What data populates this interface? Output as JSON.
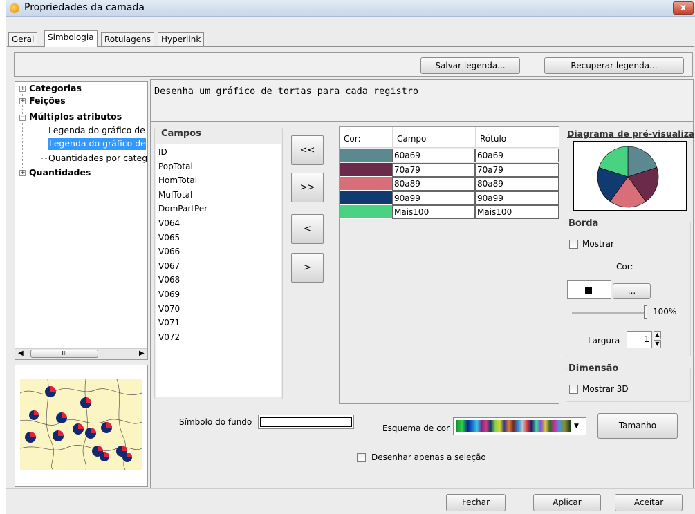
{
  "window": {
    "title": "Propriedades da camada",
    "close_label": "x"
  },
  "tabs": [
    "Geral",
    "Simbologia",
    "Rotulagens",
    "Hyperlink"
  ],
  "toolbar": {
    "save_legend": "Salvar legenda...",
    "recover_legend": "Recuperar legenda..."
  },
  "tree": {
    "categorias": "Categorias",
    "feicoes": "Feições",
    "multiplos": "Múltiplos atributos",
    "child1": "Legenda do gráfico de",
    "child2": "Legenda do gráfico de",
    "child3": "Quantidades por categ",
    "quantidades": "Quantidades"
  },
  "description": "Desenha um gráfico de tortas para cada registro",
  "campos": {
    "title": "Campos",
    "items": [
      "ID",
      "PopTotal",
      "HomTotal",
      "MulTotal",
      "DomPartPer",
      "V064",
      "V065",
      "V066",
      "V067",
      "V068",
      "V069",
      "V070",
      "V071",
      "V072"
    ]
  },
  "arrows": {
    "add_all": "<<",
    "remove_all": ">>",
    "add_one": "<",
    "remove_one": ">"
  },
  "table": {
    "headers": {
      "color": "Cor:",
      "field": "Campo",
      "label": "Rótulo"
    },
    "rows": [
      {
        "color": "#5b8891",
        "field": "60a69",
        "label": "60a69"
      },
      {
        "color": "#6b2a49",
        "field": "70a79",
        "label": "70a79"
      },
      {
        "color": "#d86e78",
        "field": "80a89",
        "label": "80a89"
      },
      {
        "color": "#103a70",
        "field": "90a99",
        "label": "90a99"
      },
      {
        "color": "#48d282",
        "field": "Mais100",
        "label": "Mais100"
      }
    ]
  },
  "preview": {
    "title": "Diagrama de pré-visualização"
  },
  "borda": {
    "title": "Borda",
    "show_label": "Mostrar",
    "color_label": "Cor:",
    "ellipsis": "...",
    "percent": "100%",
    "width_label": "Largura",
    "width_value": "1"
  },
  "dimensao": {
    "title": "Dimensão",
    "show3d_label": "Mostrar 3D"
  },
  "bottom": {
    "background_symbol_label": "Símbolo do fundo",
    "color_scheme_label": "Esquema de cor",
    "size_button": "Tamanho",
    "draw_selection_label": "Desenhar apenas a seleção"
  },
  "footer": {
    "close": "Fechar",
    "apply": "Aplicar",
    "accept": "Aceitar"
  },
  "map_preview": {
    "icon": "map-thumbnail"
  },
  "scrollbar": {
    "grip": "III"
  }
}
